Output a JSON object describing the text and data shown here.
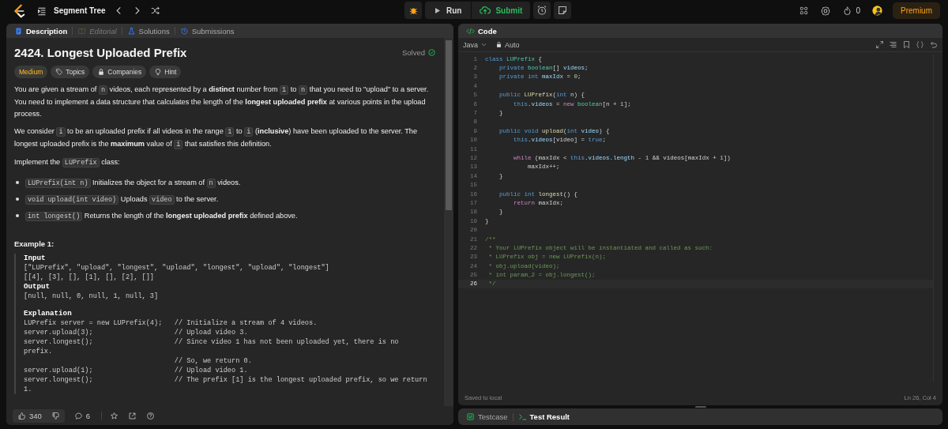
{
  "header": {
    "title": "Segment Tree",
    "run": "Run",
    "submit": "Submit",
    "streak": "0",
    "premium": "Premium"
  },
  "left_panel": {
    "tabs": [
      {
        "label": "Description",
        "selected": true,
        "disabled": false
      },
      {
        "label": "Editorial",
        "selected": false,
        "disabled": true
      },
      {
        "label": "Solutions",
        "selected": false,
        "disabled": false
      },
      {
        "label": "Submissions",
        "selected": false,
        "disabled": false
      }
    ],
    "title": "2424. Longest Uploaded Prefix",
    "status": "Solved",
    "tags": [
      {
        "kind": "difficulty",
        "label": "Medium"
      },
      {
        "kind": "topics",
        "label": "Topics"
      },
      {
        "kind": "companies",
        "label": "Companies"
      },
      {
        "kind": "hint",
        "label": "Hint"
      }
    ],
    "paragraphs": [
      [
        {
          "kind": "text",
          "text": "You are given a stream of "
        },
        {
          "kind": "code",
          "text": "n"
        },
        {
          "kind": "text",
          "text": " videos, each represented by a **distinct** number from "
        },
        {
          "kind": "code",
          "text": "1"
        },
        {
          "kind": "text",
          "text": " to "
        },
        {
          "kind": "code",
          "text": "n"
        },
        {
          "kind": "text",
          "text": " that you need to \"upload\" to a server. You need to implement a data structure that calculates the length of the **longest uploaded prefix** at various points in the upload process."
        }
      ],
      [
        {
          "kind": "text",
          "text": "We consider "
        },
        {
          "kind": "code",
          "text": "i"
        },
        {
          "kind": "text",
          "text": " to be an uploaded prefix if all videos in the range "
        },
        {
          "kind": "code",
          "text": "1"
        },
        {
          "kind": "text",
          "text": " to "
        },
        {
          "kind": "code",
          "text": "i"
        },
        {
          "kind": "text",
          "text": " (**inclusive**) have been uploaded to the server. The longest uploaded prefix is the **maximum** value of "
        },
        {
          "kind": "code",
          "text": "i"
        },
        {
          "kind": "text",
          "text": " that satisfies this definition."
        }
      ],
      [
        {
          "kind": "text",
          "text": "Implement the "
        },
        {
          "kind": "code",
          "text": "LUPrefix"
        },
        {
          "kind": "text",
          "text": " class:"
        }
      ]
    ],
    "bullets": [
      [
        {
          "kind": "code",
          "text": "LUPrefix(int n)"
        },
        {
          "kind": "text",
          "text": " Initializes the object for a stream of "
        },
        {
          "kind": "code",
          "text": "n"
        },
        {
          "kind": "text",
          "text": " videos."
        }
      ],
      [
        {
          "kind": "code",
          "text": "void upload(int video)"
        },
        {
          "kind": "text",
          "text": " Uploads "
        },
        {
          "kind": "code",
          "text": "video"
        },
        {
          "kind": "text",
          "text": " to the server."
        }
      ],
      [
        {
          "kind": "code",
          "text": "int longest()"
        },
        {
          "kind": "text",
          "text": " Returns the length of the **longest uploaded prefix** defined above."
        }
      ]
    ],
    "example": {
      "heading": "Example 1:",
      "lines": [
        {
          "kind": "label",
          "text": "Input"
        },
        {
          "kind": "text",
          "text": "[\"LUPrefix\", \"upload\", \"longest\", \"upload\", \"longest\", \"upload\", \"longest\"]"
        },
        {
          "kind": "text",
          "text": "[[4], [3], [], [1], [], [2], []]"
        },
        {
          "kind": "label",
          "text": "Output"
        },
        {
          "kind": "text",
          "text": "[null, null, 0, null, 1, null, 3]"
        },
        {
          "kind": "label",
          "text": "Explanation",
          "gap_before": true
        },
        {
          "kind": "text",
          "text": "LUPrefix server = new LUPrefix(4);   // Initialize a stream of 4 videos."
        },
        {
          "kind": "text",
          "text": "server.upload(3);                    // Upload video 3."
        },
        {
          "kind": "text",
          "text": "server.longest();                    // Since video 1 has not been uploaded yet, there is no"
        },
        {
          "kind": "text",
          "text": "prefix."
        },
        {
          "kind": "text",
          "text": "                                     // So, we return 0."
        },
        {
          "kind": "text",
          "text": "server.upload(1);                    // Upload video 1."
        },
        {
          "kind": "text",
          "text": "server.longest();                    // The prefix [1] is the longest uploaded prefix, so we return"
        },
        {
          "kind": "text",
          "text": "1."
        }
      ]
    },
    "footer": {
      "likes": "340",
      "comments": "6"
    }
  },
  "code_panel": {
    "title": "Code",
    "language": "Java",
    "mode": "Auto",
    "lines": [
      {
        "n": "1",
        "current": false,
        "tokens": [
          {
            "kind": "kw",
            "text": "class "
          },
          {
            "kind": "type",
            "text": "LUPrefix"
          },
          {
            "kind": "p",
            "text": " {"
          }
        ]
      },
      {
        "n": "2",
        "current": false,
        "tokens": [
          {
            "kind": "kw",
            "text": "    private "
          },
          {
            "kind": "type",
            "text": "boolean"
          },
          {
            "kind": "p",
            "text": "[] "
          },
          {
            "kind": "var",
            "text": "videos"
          },
          {
            "kind": "p",
            "text": ";"
          }
        ]
      },
      {
        "n": "3",
        "current": false,
        "tokens": [
          {
            "kind": "kw",
            "text": "    private int "
          },
          {
            "kind": "var",
            "text": "maxIdx"
          },
          {
            "kind": "p",
            "text": " = "
          },
          {
            "kind": "num",
            "text": "0"
          },
          {
            "kind": "p",
            "text": ";"
          }
        ]
      },
      {
        "n": "4",
        "current": false
      },
      {
        "n": "5",
        "current": false,
        "tokens": [
          {
            "kind": "kw",
            "text": "    public "
          },
          {
            "kind": "fn",
            "text": "LUPrefix"
          },
          {
            "kind": "p",
            "text": "("
          },
          {
            "kind": "kw",
            "text": "int "
          },
          {
            "kind": "var",
            "text": "n"
          },
          {
            "kind": "p",
            "text": ") {"
          }
        ]
      },
      {
        "n": "6",
        "current": false,
        "tokens": [
          {
            "kind": "kw",
            "text": "        this"
          },
          {
            "kind": "p",
            "text": "."
          },
          {
            "kind": "var",
            "text": "videos"
          },
          {
            "kind": "p",
            "text": " = "
          },
          {
            "kind": "ctl",
            "text": "new "
          },
          {
            "kind": "type",
            "text": "boolean"
          },
          {
            "kind": "p",
            "text": "[n + "
          },
          {
            "kind": "num",
            "text": "1"
          },
          {
            "kind": "p",
            "text": "];"
          }
        ]
      },
      {
        "n": "7",
        "current": false,
        "tokens": [
          {
            "kind": "p",
            "text": "    }"
          }
        ]
      },
      {
        "n": "8",
        "current": false
      },
      {
        "n": "9",
        "current": false,
        "tokens": [
          {
            "kind": "kw",
            "text": "    public void "
          },
          {
            "kind": "fn",
            "text": "upload"
          },
          {
            "kind": "p",
            "text": "("
          },
          {
            "kind": "kw",
            "text": "int "
          },
          {
            "kind": "var",
            "text": "video"
          },
          {
            "kind": "p",
            "text": ") {"
          }
        ]
      },
      {
        "n": "10",
        "current": false,
        "tokens": [
          {
            "kind": "kw",
            "text": "        this"
          },
          {
            "kind": "p",
            "text": "."
          },
          {
            "kind": "var",
            "text": "videos"
          },
          {
            "kind": "p",
            "text": "[video] = "
          },
          {
            "kind": "kw",
            "text": "true"
          },
          {
            "kind": "p",
            "text": ";"
          }
        ]
      },
      {
        "n": "11",
        "current": false
      },
      {
        "n": "12",
        "current": false,
        "tokens": [
          {
            "kind": "ctl",
            "text": "        while"
          },
          {
            "kind": "p",
            "text": " (maxIdx < "
          },
          {
            "kind": "kw",
            "text": "this"
          },
          {
            "kind": "p",
            "text": "."
          },
          {
            "kind": "var",
            "text": "videos"
          },
          {
            "kind": "p",
            "text": "."
          },
          {
            "kind": "var",
            "text": "length"
          },
          {
            "kind": "p",
            "text": " - "
          },
          {
            "kind": "num",
            "text": "1"
          },
          {
            "kind": "p",
            "text": " && videos[maxIdx + "
          },
          {
            "kind": "num",
            "text": "1"
          },
          {
            "kind": "p",
            "text": "])"
          }
        ]
      },
      {
        "n": "13",
        "current": false,
        "tokens": [
          {
            "kind": "p",
            "text": "            maxIdx++;"
          }
        ]
      },
      {
        "n": "14",
        "current": false,
        "tokens": [
          {
            "kind": "p",
            "text": "    }"
          }
        ]
      },
      {
        "n": "15",
        "current": false
      },
      {
        "n": "16",
        "current": false,
        "tokens": [
          {
            "kind": "kw",
            "text": "    public int "
          },
          {
            "kind": "fn",
            "text": "longest"
          },
          {
            "kind": "p",
            "text": "() {"
          }
        ]
      },
      {
        "n": "17",
        "current": false,
        "tokens": [
          {
            "kind": "ctl",
            "text": "        return"
          },
          {
            "kind": "p",
            "text": " maxIdx;"
          }
        ]
      },
      {
        "n": "18",
        "current": false,
        "tokens": [
          {
            "kind": "p",
            "text": "    }"
          }
        ]
      },
      {
        "n": "19",
        "current": false,
        "tokens": [
          {
            "kind": "p",
            "text": "}"
          }
        ]
      },
      {
        "n": "20",
        "current": false
      },
      {
        "n": "21",
        "current": false,
        "tokens": [
          {
            "kind": "cmt",
            "text": "/**"
          }
        ]
      },
      {
        "n": "22",
        "current": false,
        "tokens": [
          {
            "kind": "cmt",
            "text": " * Your LUPrefix object will be instantiated and called as such:"
          }
        ]
      },
      {
        "n": "23",
        "current": false,
        "tokens": [
          {
            "kind": "cmt",
            "text": " * LUPrefix obj = new LUPrefix(n);"
          }
        ]
      },
      {
        "n": "24",
        "current": false,
        "tokens": [
          {
            "kind": "cmt",
            "text": " * obj.upload(video);"
          }
        ]
      },
      {
        "n": "25",
        "current": false,
        "tokens": [
          {
            "kind": "cmt",
            "text": " * int param_2 = obj.longest();"
          }
        ]
      },
      {
        "n": "26",
        "current": true,
        "tokens": [
          {
            "kind": "cmt",
            "text": " */"
          }
        ]
      }
    ],
    "saved": "Saved to local",
    "cursor": "Ln 26, Col 4"
  },
  "bottom_tabs": [
    {
      "label": "Testcase",
      "selected": false
    },
    {
      "label": "Test Result",
      "selected": true
    }
  ]
}
